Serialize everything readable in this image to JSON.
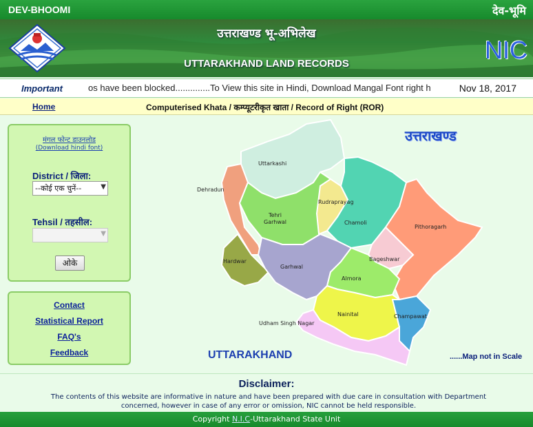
{
  "topbar": {
    "left_title": "DEV-BHOOMI",
    "right_title": "देव-भूमि"
  },
  "banner": {
    "hindi_title": "उत्तराखण्ड भू-अभिलेख",
    "english_title": "UTTARAKHAND LAND RECORDS",
    "nic_logo_text": "NIC"
  },
  "ticker": {
    "label": "Important",
    "message": "os have been blocked..............To View this site in Hindi, Download Mangal Font right h",
    "date": "Nov 18, 2017"
  },
  "nav": {
    "home": "Home",
    "breadcrumb": "Computerised Khata / कम्प्यूटरीकृत खाता / Record of Right (ROR)"
  },
  "sidebar": {
    "font_link_hindi": "मंगल फोन्ट डाउनलोड",
    "font_link_english": "(Download hindi font)",
    "district_label": "District / जिला:",
    "district_value": "--कोई एक चुनें--",
    "tehsil_label": "Tehsil / तहसील:",
    "tehsil_value": "",
    "ok_button": "ओके",
    "links": [
      "Contact",
      "Statistical Report",
      "FAQ's",
      "Feedback"
    ]
  },
  "map": {
    "title_hindi": "उत्तराखण्ड",
    "title_english": "UTTARAKHAND",
    "note": "......Map not in Scale",
    "districts": {
      "uttarkashi": "Uttarkashi",
      "dehradun": "Dehradun",
      "tehri": "Tehri",
      "garhwal_tehri": "Garhwal",
      "rudraprayag": "Rudraprayag",
      "chamoli": "Chamoli",
      "pithoragarh": "Pithoragarh",
      "haridwar": "Hardwar",
      "garhwal": "Garhwal",
      "bageshwar": "Bageshwar",
      "almora": "Almora",
      "nainital": "Nainital",
      "champawat": "Champawat",
      "usnagar": "Udham Singh Nagar"
    },
    "colors": {
      "uttarkashi": "#cfeee0",
      "dehradun": "#f0a07e",
      "tehri": "#8fe06a",
      "rudraprayag": "#f3e98f",
      "chamoli": "#52d4b2",
      "pithoragarh": "#ff9b78",
      "haridwar": "#98a847",
      "garhwal": "#a7a5cf",
      "bageshwar": "#f7cbd3",
      "almora": "#9deb6a",
      "nainital": "#eef54a",
      "champawat": "#4aa6d9",
      "usnagar": "#f5c8f5"
    }
  },
  "disclaimer": {
    "title": "Disclaimer:",
    "text": "The contents of this website are informative in nature and have been prepared with due care in consultation with Department concerned, however in case of any error or omission, NIC cannot be held responsible."
  },
  "footer": {
    "prefix": "Copyright ",
    "nic": "N.I.C",
    "suffix": "-Uttarakhand State Unit"
  }
}
